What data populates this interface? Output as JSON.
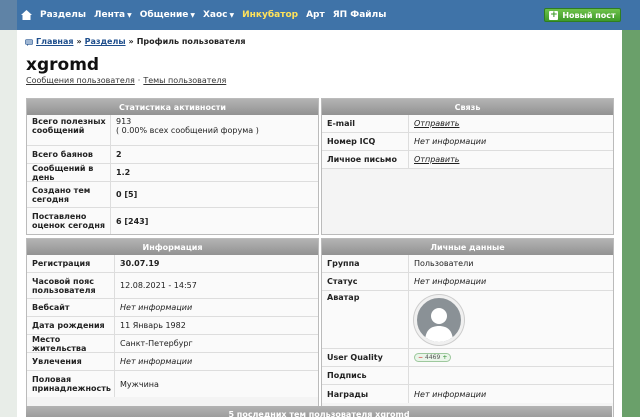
{
  "nav": {
    "items": [
      {
        "label": "Разделы",
        "caret": false,
        "active": false
      },
      {
        "label": "Лента",
        "caret": true,
        "active": false
      },
      {
        "label": "Общение",
        "caret": true,
        "active": false
      },
      {
        "label": "Хаос",
        "caret": true,
        "active": false
      },
      {
        "label": "Инкубатор",
        "caret": false,
        "active": true
      },
      {
        "label": "Арт",
        "caret": false,
        "active": false
      },
      {
        "label": "ЯП Файлы",
        "caret": false,
        "active": false
      }
    ],
    "new_post_label": "Новый пост"
  },
  "breadcrumb": {
    "home": "Главная",
    "sep": "»",
    "section": "Разделы",
    "current": "Профиль пользователя"
  },
  "profile": {
    "username": "xgromd",
    "posts_link": "Сообщения пользователя",
    "separator": "·",
    "topics_link": "Темы пользователя"
  },
  "activity": {
    "title": "Статистика активности",
    "rows": [
      {
        "label": "Всего полезных сообщений",
        "value": "913",
        "sub": "( 0.00% всех сообщений форума )"
      },
      {
        "label": "Всего баянов",
        "value": "2"
      },
      {
        "label": "Сообщений в день",
        "value": "1.2"
      },
      {
        "label": "Создано тем сегодня",
        "value": "0 [5]"
      },
      {
        "label": "Поставлено оценок сегодня",
        "value": "6 [243]"
      }
    ]
  },
  "contact": {
    "title": "Связь",
    "rows": [
      {
        "label": "E-mail",
        "value": "Отправить"
      },
      {
        "label": "Номер ICQ",
        "value": "Нет информации"
      },
      {
        "label": "Личное письмо",
        "value": "Отправить"
      }
    ]
  },
  "info": {
    "title": "Информация",
    "rows": [
      {
        "label": "Регистрация",
        "value": "30.07.19"
      },
      {
        "label": "Часовой пояс пользователя",
        "value": "12.08.2021 - 14:57"
      },
      {
        "label": "Вебсайт",
        "value": "Нет информации"
      },
      {
        "label": "Дата рождения",
        "value": "11 Январь 1982"
      },
      {
        "label": "Место жительства",
        "value": "Санкт-Петербург"
      },
      {
        "label": "Увлечения",
        "value": "Нет информации"
      },
      {
        "label": "Половая принадлежность",
        "value": "Мужчина"
      }
    ]
  },
  "personal": {
    "title": "Личные данные",
    "rows": [
      {
        "label": "Группа",
        "value": "Пользователи"
      },
      {
        "label": "Статус",
        "value": "Нет информации"
      },
      {
        "label": "Аватар",
        "value": ""
      },
      {
        "label": "User Quality",
        "value": "4469"
      },
      {
        "label": "Подпись",
        "value": ""
      },
      {
        "label": "Награды",
        "value": "Нет информации"
      }
    ],
    "quality_minus": "−",
    "quality_plus": "+"
  },
  "bottom_title": "5 последних тем пользователя xgromd",
  "colors": {
    "topbar": "#3f73a8",
    "active_nav": "#ffe25a",
    "new_post": "#4aa832",
    "panel_header": "#a3a3a3",
    "link": "#1e4e8c"
  }
}
